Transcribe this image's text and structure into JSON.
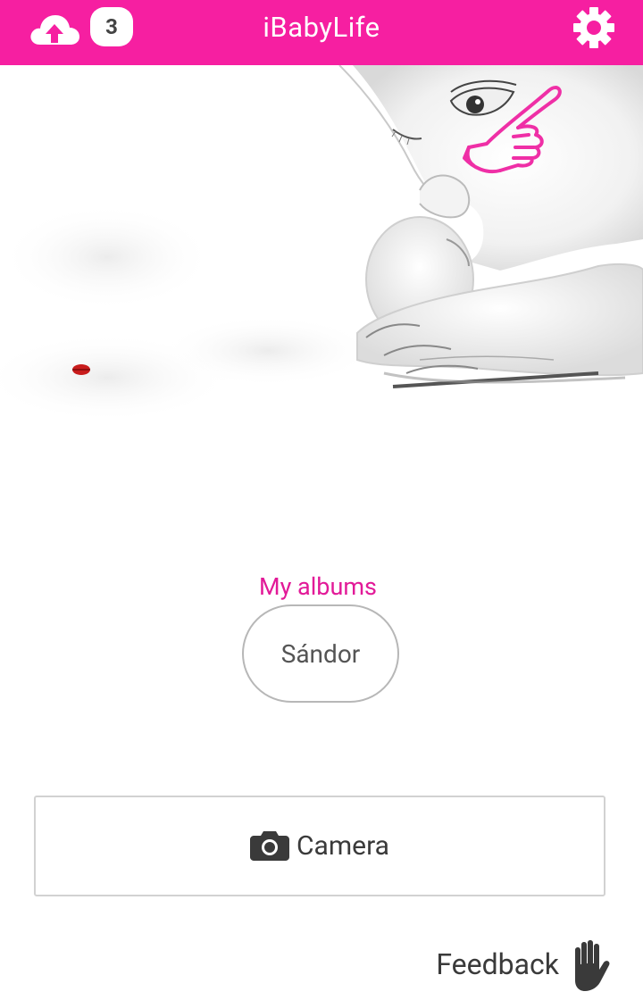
{
  "header": {
    "title": "iBabyLife",
    "upload_count": "3",
    "upload_icon": "cloud-upload-icon",
    "settings_icon": "gear-icon",
    "bg_color": "#f61fa1"
  },
  "albums": {
    "heading": "My albums",
    "items": [
      {
        "label": "Sándor"
      }
    ]
  },
  "camera": {
    "label": "Camera",
    "icon": "camera-icon"
  },
  "feedback": {
    "label": "Feedback",
    "icon": "hand-icon"
  },
  "colors": {
    "accent": "#f61fa1",
    "album_heading": "#e21a98",
    "text": "#3a3a3a"
  }
}
